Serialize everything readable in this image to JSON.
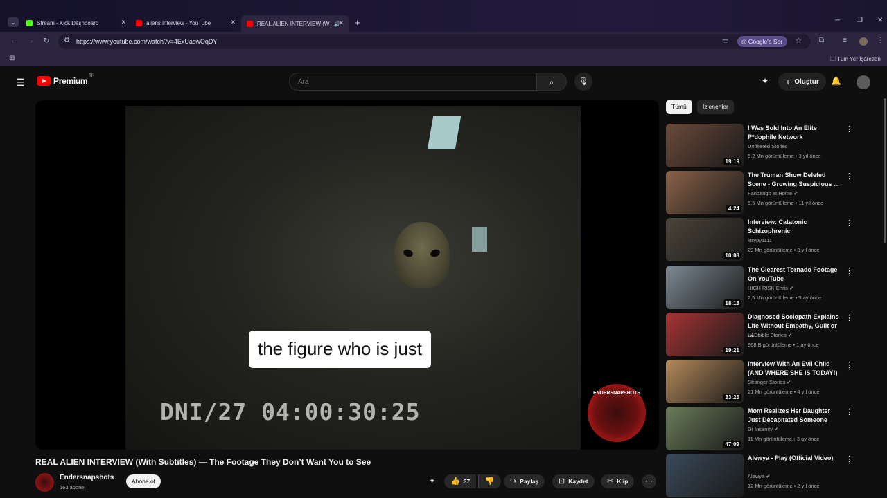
{
  "browser": {
    "tabs": [
      {
        "label": "Stream - Kick Dashboard",
        "icon": "kick-icon",
        "color": "#53fc18"
      },
      {
        "label": "aliens interview - YouTube",
        "icon": "youtube-icon",
        "color": "#ff0000"
      },
      {
        "label": "REAL ALIEN INTERVIEW (W",
        "icon": "youtube-icon",
        "color": "#ff0000",
        "active": true
      }
    ],
    "url": "https://www.youtube.com/watch?v=4ExUaswOqDY",
    "google_chip": "Google'a Sor",
    "bookmarks_all": "Tüm Yer İşaretleri"
  },
  "youtube": {
    "brand": "Premium",
    "country": "TR",
    "search_placeholder": "Ara",
    "create_label": "Oluştur"
  },
  "player": {
    "subtitle": "the figure who is just",
    "timecode": "DNI/27 04:00:30:25",
    "badge_text": "ENDERSNAPSHOTS"
  },
  "video": {
    "title": "REAL ALIEN INTERVIEW (With Subtitles) — The Footage They Don’t Want You to See",
    "channel": "Endersnapshots",
    "subscribers": "163 abone",
    "subscribe_label": "Abone ol",
    "likes": "37",
    "share_label": "Paylaş",
    "save_label": "Kaydet",
    "clip_label": "Klip"
  },
  "sidebar": {
    "chips": [
      "Tümü",
      "İzlenenler"
    ],
    "items": [
      {
        "title": "I Was Sold Into An Elite P*dophile Network",
        "channel": "Unfiltered Stories",
        "meta": "5,2 Mn görüntüleme • 3 yıl önce",
        "duration": "19:19",
        "verified": false,
        "thumb": "#6b4a3a"
      },
      {
        "title": "The Truman Show Deleted Scene - Growing Suspicious ...",
        "channel": "Fandango at Home",
        "meta": "5,5 Mn görüntüleme • 11 yıl önce",
        "duration": "4:24",
        "verified": true,
        "thumb": "#8a6248"
      },
      {
        "title": "Interview: Catatonic Schizophrenic",
        "channel": "ktrypy1111",
        "meta": "29 Mn görüntüleme • 8 yıl önce",
        "duration": "10:08",
        "verified": false,
        "thumb": "#4a4438"
      },
      {
        "title": "The Clearest Tornado Footage On YouTube",
        "channel": "HIGH RISK Chris",
        "meta": "2,5 Mn görüntüleme • 3 ay önce",
        "duration": "18:18",
        "verified": true,
        "thumb": "#7d8a94"
      },
      {
        "title": "Diagnosed Sociopath Explains Life Without Empathy, Guilt or ...",
        "channel": "LADbible Stories",
        "meta": "968 B görüntüleme • 1 ay önce",
        "duration": "19:21",
        "verified": true,
        "thumb": "#a83434"
      },
      {
        "title": "Interview With An Evil Child (AND WHERE SHE IS TODAY!)",
        "channel": "Stranger Stories",
        "meta": "21 Mn görüntüleme • 4 yıl önce",
        "duration": "33:25",
        "verified": true,
        "thumb": "#b58a5a"
      },
      {
        "title": "Mom Realizes Her Daughter Just Decapitated Someone",
        "channel": "Dr Insanity",
        "meta": "11 Mn görüntüleme • 3 ay önce",
        "duration": "47:09",
        "verified": true,
        "thumb": "#6a7d5a"
      },
      {
        "title": "Alewya - Play (Official Video)",
        "channel": "Alewya",
        "meta": "12 Mn görüntüleme • 2 yıl önce",
        "duration": "",
        "verified": true,
        "thumb": "#3a4a5a"
      }
    ]
  }
}
